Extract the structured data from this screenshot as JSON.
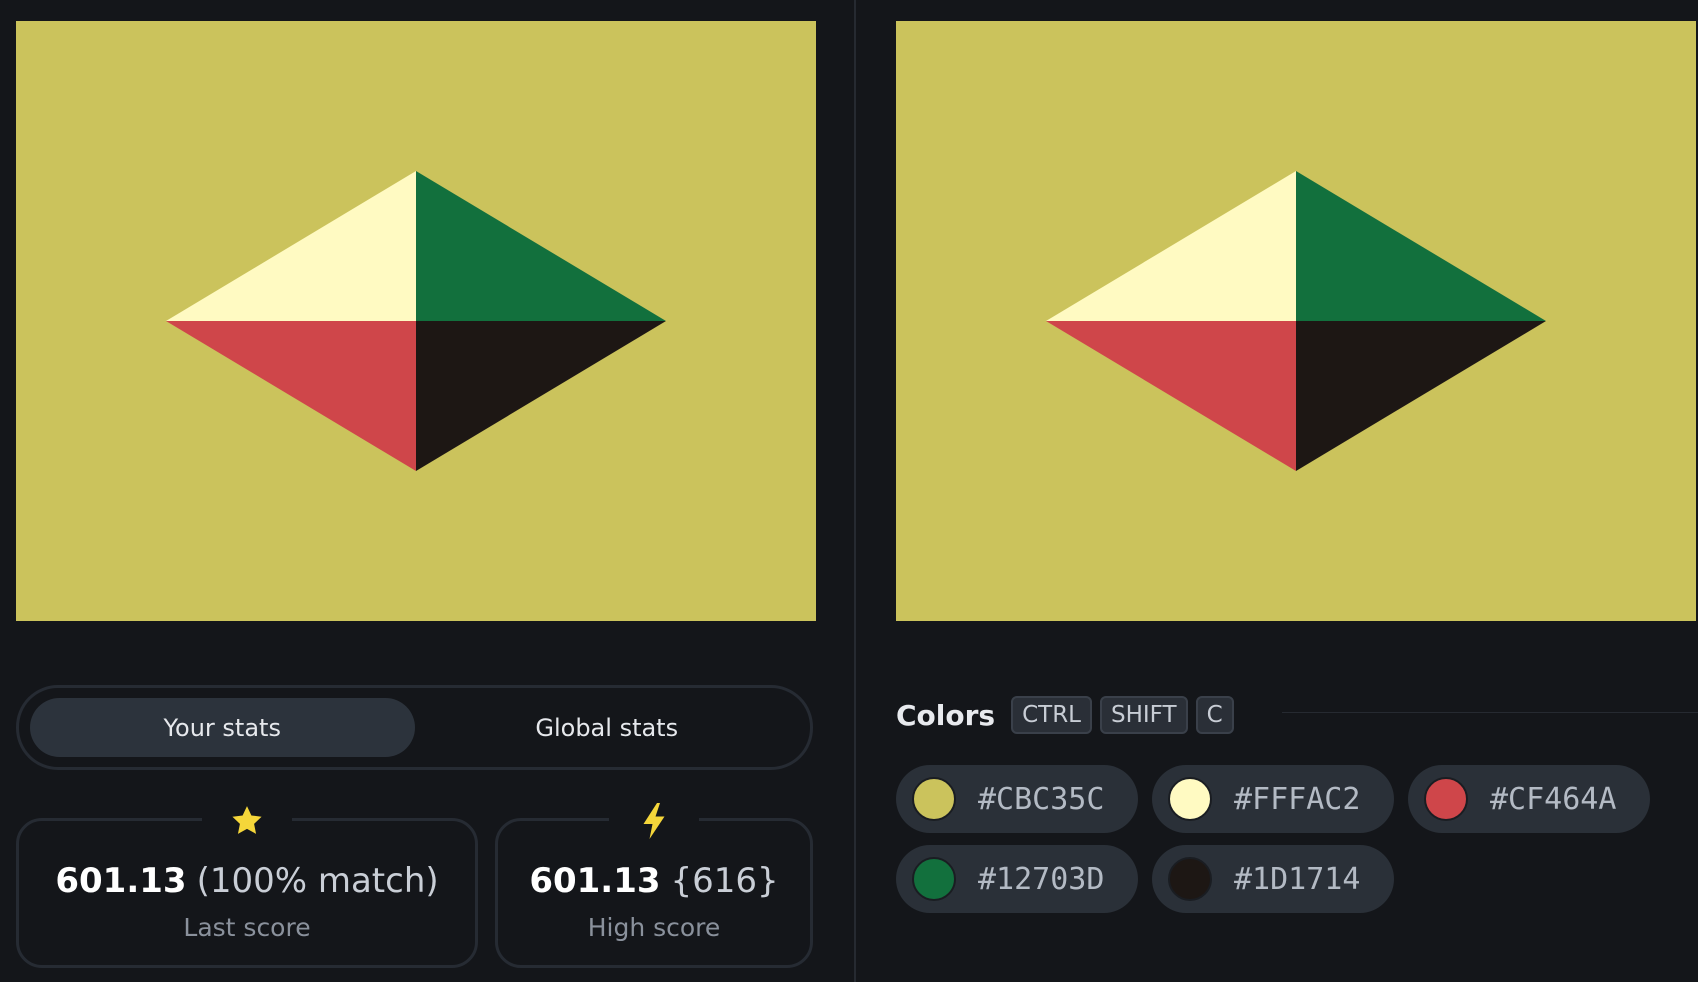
{
  "canvases": {
    "background": "#CBC35C",
    "shapes": {
      "top_left": "#FFFAC2",
      "top_right": "#12703D",
      "bottom_left": "#CF464A",
      "bottom_right": "#1D1714"
    }
  },
  "stats": {
    "tabs": [
      "Your stats",
      "Global stats"
    ],
    "active_tab": "Your stats",
    "last_score": {
      "icon": "star-icon",
      "value": "601.13",
      "detail": "(100% match)",
      "label": "Last score"
    },
    "high_score": {
      "icon": "lightning-icon",
      "value": "601.13",
      "detail": "{616}",
      "label": "High score"
    }
  },
  "colors": {
    "title": "Colors",
    "shortcut": [
      "CTRL",
      "SHIFT",
      "C"
    ],
    "swatches": [
      {
        "hex": "#CBC35C"
      },
      {
        "hex": "#FFFAC2"
      },
      {
        "hex": "#CF464A"
      },
      {
        "hex": "#12703D"
      },
      {
        "hex": "#1D1714"
      }
    ]
  },
  "accent": {
    "icon_yellow": "#F5D63A",
    "panel": "#2c333c"
  }
}
